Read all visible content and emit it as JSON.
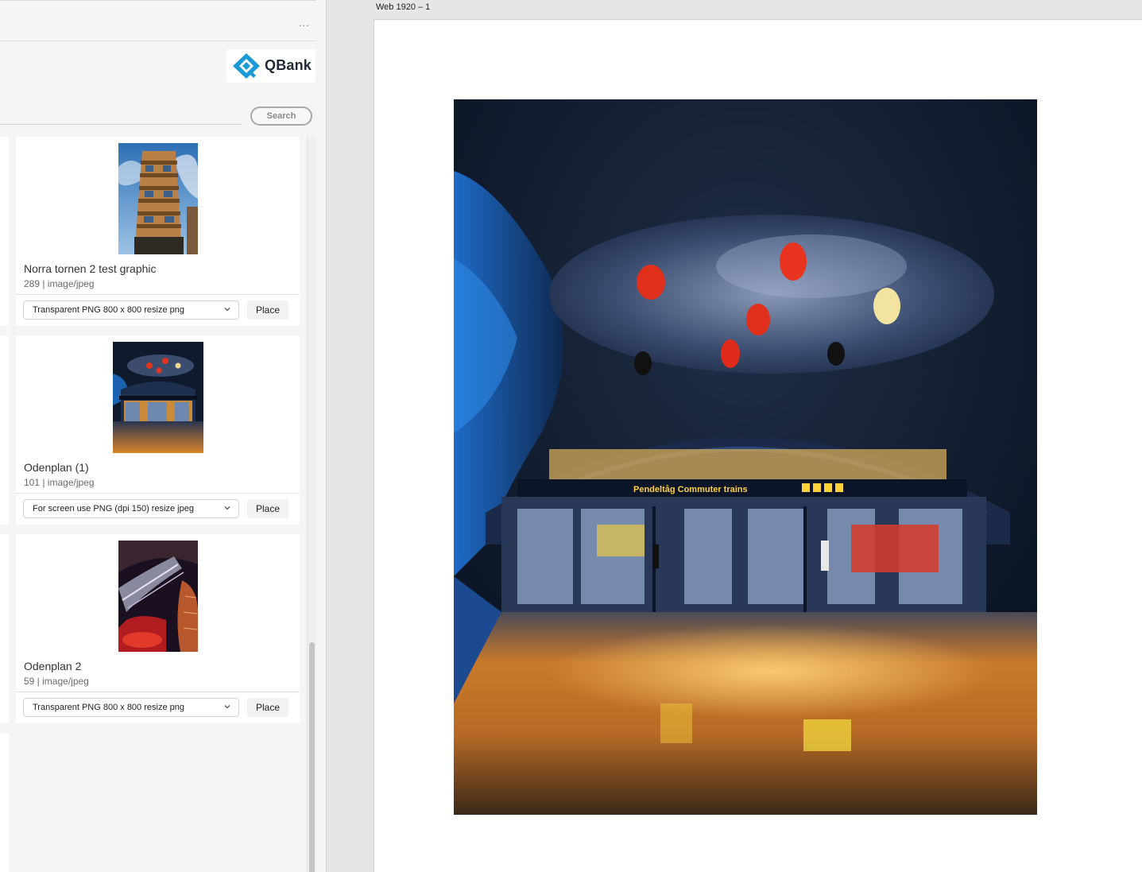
{
  "panel": {
    "more_label": "...",
    "logo_text": "QBank",
    "search_label": "Search"
  },
  "assets": [
    {
      "title": "Norra tornen 2 test graphic",
      "meta": "289 | image/jpeg",
      "format": "Transparent PNG 800 x 800 resize png",
      "place_label": "Place"
    },
    {
      "title": "Odenplan (1)",
      "meta": "101 | image/jpeg",
      "format": "For screen use PNG (dpi 150) resize jpeg",
      "place_label": "Place"
    },
    {
      "title": "Odenplan 2",
      "meta": "59 | image/jpeg",
      "format": "Transparent PNG 800 x 800 resize png",
      "place_label": "Place"
    }
  ],
  "artboard": {
    "label": "Web 1920 – 1",
    "image_signage": "Pendeltåg Commuter trains"
  },
  "colors": {
    "brand": "#1a9ad6",
    "panel_bg": "#f5f5f5",
    "canvas_bg": "#e6e6e6"
  }
}
